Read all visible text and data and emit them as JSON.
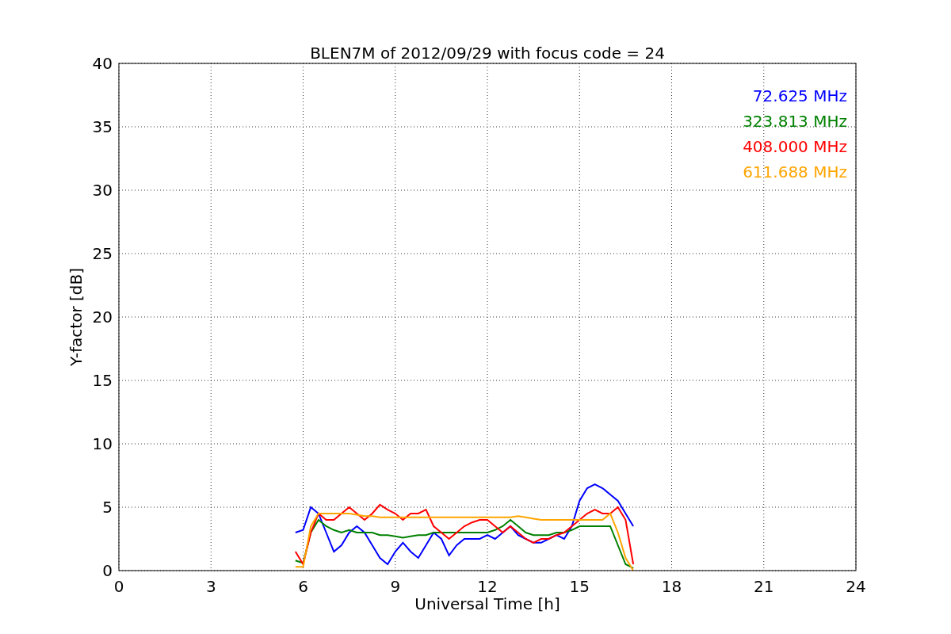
{
  "chart_data": {
    "type": "line",
    "title": "BLEN7M of 2012/09/29 with focus code = 24",
    "xlabel": "Universal Time [h]",
    "ylabel": "Y-factor [dB]",
    "x": [
      5.75,
      6,
      6.25,
      6.5,
      6.75,
      7,
      7.25,
      7.5,
      7.75,
      8,
      8.25,
      8.5,
      8.75,
      9,
      9.25,
      9.5,
      9.75,
      10,
      10.25,
      10.5,
      10.75,
      11,
      11.25,
      11.5,
      11.75,
      12,
      12.25,
      12.5,
      12.75,
      13,
      13.25,
      13.5,
      13.75,
      14,
      14.25,
      14.5,
      14.75,
      15,
      15.25,
      15.5,
      15.75,
      16,
      16.25,
      16.5,
      16.75
    ],
    "series": [
      {
        "name": "72.625 MHz",
        "color": "#0000ff",
        "values": [
          3,
          3.2,
          5,
          4.5,
          3,
          1.5,
          2,
          3,
          3.5,
          3,
          2,
          1,
          0.5,
          1.5,
          2.2,
          1.5,
          1,
          2,
          3,
          2.5,
          1.2,
          2,
          2.5,
          2.5,
          2.5,
          2.8,
          2.5,
          3,
          3.5,
          2.8,
          2.5,
          2.2,
          2.2,
          2.5,
          2.8,
          2.5,
          3.5,
          5.5,
          6.5,
          6.8,
          6.5,
          6,
          5.5,
          4.5,
          3.5
        ]
      },
      {
        "name": "323.813 MHz",
        "color": "#008000",
        "values": [
          0.8,
          0.6,
          3,
          4,
          3.5,
          3.2,
          3,
          3.2,
          3,
          3,
          3,
          2.8,
          2.8,
          2.7,
          2.6,
          2.7,
          2.8,
          2.8,
          3,
          3,
          3,
          3,
          3,
          3,
          3,
          3,
          3.2,
          3.5,
          4,
          3.5,
          3,
          2.8,
          2.8,
          2.8,
          3,
          3,
          3.2,
          3.5,
          3.5,
          3.5,
          3.5,
          3.5,
          2,
          0.5,
          0.2
        ]
      },
      {
        "name": "408.000 MHz",
        "color": "#ff0000",
        "values": [
          1.5,
          0.5,
          3,
          4.5,
          4,
          4,
          4.5,
          5,
          4.5,
          4,
          4.5,
          5.2,
          4.8,
          4.5,
          4,
          4.5,
          4.5,
          4.8,
          3.5,
          3,
          2.5,
          3,
          3.5,
          3.8,
          4,
          4,
          3.5,
          3,
          3.5,
          3,
          2.5,
          2.2,
          2.5,
          2.5,
          2.8,
          3,
          3.5,
          4,
          4.5,
          4.8,
          4.5,
          4.5,
          5,
          4,
          0.5
        ]
      },
      {
        "name": "611.688 MHz",
        "color": "#ffa500",
        "values": [
          0.3,
          0.3,
          3.5,
          4.5,
          4.5,
          4.5,
          4.5,
          4.5,
          4.4,
          4.3,
          4.3,
          4.2,
          4.2,
          4.2,
          4.2,
          4.2,
          4.2,
          4.2,
          4.2,
          4.2,
          4.2,
          4.2,
          4.2,
          4.2,
          4.2,
          4.2,
          4.2,
          4.2,
          4.2,
          4.3,
          4.2,
          4.1,
          4,
          4,
          4,
          4,
          4,
          4,
          4,
          4,
          4,
          4.5,
          3,
          1,
          0
        ]
      }
    ],
    "grid": true,
    "xlim": [
      0,
      24
    ],
    "ylim": [
      0,
      40
    ],
    "xticks": [
      0,
      3,
      6,
      9,
      12,
      15,
      18,
      21,
      24
    ],
    "yticks": [
      0,
      5,
      10,
      15,
      20,
      25,
      30,
      35,
      40
    ]
  }
}
